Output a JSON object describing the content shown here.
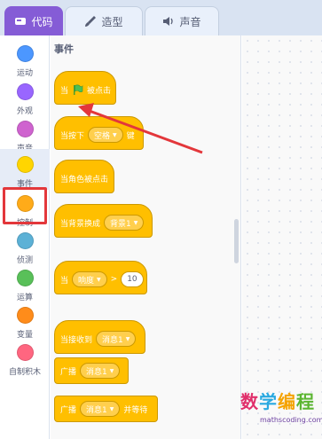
{
  "tabs": {
    "code": {
      "label": "代码",
      "icon": "code-icon"
    },
    "costume": {
      "label": "造型",
      "icon": "brush-icon"
    },
    "sound": {
      "label": "声音",
      "icon": "speaker-icon"
    }
  },
  "categories": [
    {
      "label": "运动",
      "color": "#4c97ff"
    },
    {
      "label": "外观",
      "color": "#9966ff"
    },
    {
      "label": "声音",
      "color": "#cf63cf"
    },
    {
      "label": "事件",
      "color": "#ffd500",
      "selected": true
    },
    {
      "label": "控制",
      "color": "#ffab19"
    },
    {
      "label": "侦测",
      "color": "#5cb1d6"
    },
    {
      "label": "运算",
      "color": "#59c059"
    },
    {
      "label": "变量",
      "color": "#ff8c1a"
    },
    {
      "label": "自制积木",
      "color": "#ff6680"
    }
  ],
  "palette": {
    "section_title": "事件",
    "blocks": {
      "flag_clicked": {
        "prefix": "当",
        "suffix": "被点击",
        "icon": "green-flag-icon"
      },
      "key_pressed": {
        "prefix": "当按下",
        "dropdown": "空格",
        "suffix": "键"
      },
      "sprite_clicked": {
        "text": "当角色被点击"
      },
      "backdrop_switch": {
        "prefix": "当背景换成",
        "dropdown": "背景1"
      },
      "loudness": {
        "prefix": "当",
        "dropdown": "响度",
        "operator": ">",
        "value": "10"
      },
      "receive": {
        "prefix": "当接收到",
        "dropdown": "消息1"
      },
      "broadcast": {
        "prefix": "广播",
        "dropdown": "消息1"
      },
      "broadcast_wait": {
        "prefix": "广播",
        "dropdown": "消息1",
        "suffix": "并等待"
      }
    }
  },
  "watermark": {
    "chars": [
      "数",
      "学",
      "编",
      "程"
    ],
    "char_colors": [
      "#e02f6b",
      "#2aa9e0",
      "#f5a300",
      "#5bb531"
    ],
    "url": "mathscoding.com"
  },
  "colors": {
    "event_block": "#ffbf00",
    "event_block_border": "#cc9900",
    "highlight": "#e3373b",
    "tab_active": "#855cd6"
  }
}
